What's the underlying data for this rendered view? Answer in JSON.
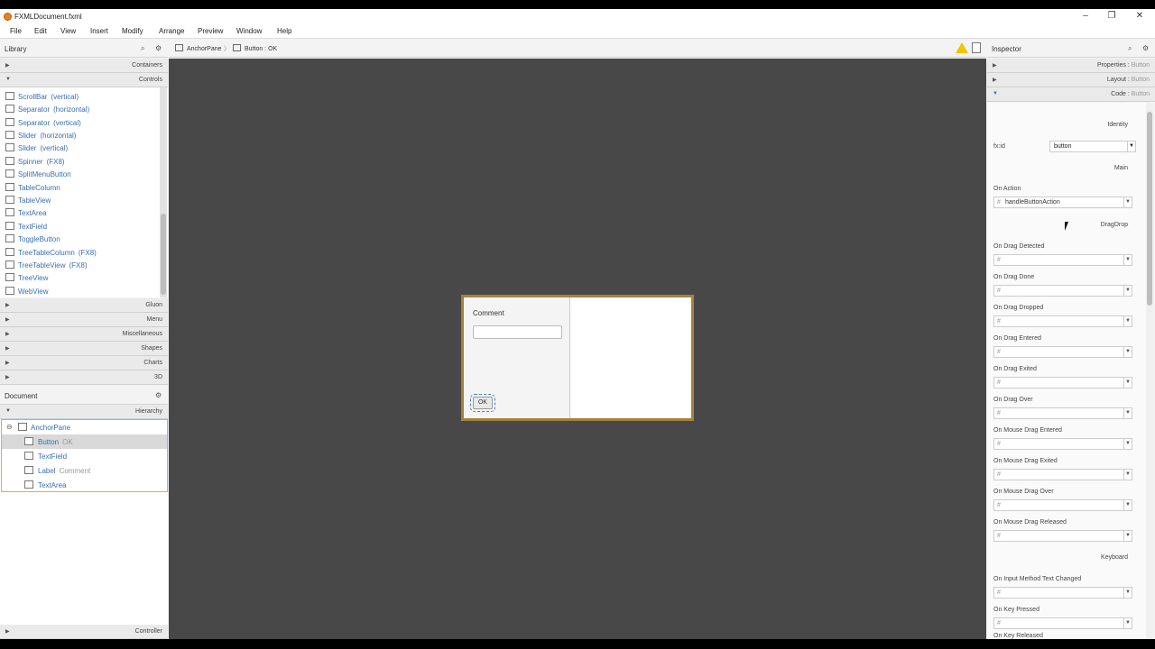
{
  "window": {
    "title": "FXMLDocument.fxml"
  },
  "menu": [
    "File",
    "Edit",
    "View",
    "Insert",
    "Modify",
    "Arrange",
    "Preview",
    "Window",
    "Help"
  ],
  "library": {
    "title": "Library",
    "sections_top": [
      "Containers",
      "Controls"
    ],
    "items": [
      {
        "name": "ScrollBar",
        "sub": "(vertical)"
      },
      {
        "name": "Separator",
        "sub": "(horizontal)"
      },
      {
        "name": "Separator",
        "sub": "(vertical)"
      },
      {
        "name": "Slider",
        "sub": "(horizontal)"
      },
      {
        "name": "Slider",
        "sub": "(vertical)"
      },
      {
        "name": "Spinner",
        "sub": "(FX8)"
      },
      {
        "name": "SplitMenuButton",
        "sub": ""
      },
      {
        "name": "TableColumn",
        "sub": ""
      },
      {
        "name": "TableView",
        "sub": ""
      },
      {
        "name": "TextArea",
        "sub": ""
      },
      {
        "name": "TextField",
        "sub": ""
      },
      {
        "name": "ToggleButton",
        "sub": ""
      },
      {
        "name": "TreeTableColumn",
        "sub": "(FX8)"
      },
      {
        "name": "TreeTableView",
        "sub": "(FX8)"
      },
      {
        "name": "TreeView",
        "sub": ""
      },
      {
        "name": "WebView",
        "sub": ""
      }
    ],
    "sections_bottom": [
      "Gluon",
      "Menu",
      "Miscellaneous",
      "Shapes",
      "Charts",
      "3D"
    ]
  },
  "document": {
    "title": "Document",
    "hierarchy_label": "Hierarchy",
    "tree": [
      {
        "name": "AnchorPane",
        "sub": ""
      },
      {
        "name": "Button",
        "sub": "OK"
      },
      {
        "name": "TextField",
        "sub": ""
      },
      {
        "name": "Label",
        "sub": "Comment"
      },
      {
        "name": "TextArea",
        "sub": ""
      }
    ],
    "controller_label": "Controller"
  },
  "breadcrumb": [
    {
      "label": "AnchorPane"
    },
    {
      "label": "Button : OK"
    }
  ],
  "stage": {
    "label": "Comment",
    "button": "OK"
  },
  "inspector": {
    "title": "Inspector",
    "sections": [
      {
        "label": "Properties : ",
        "sub": "Button"
      },
      {
        "label": "Layout : ",
        "sub": "Button"
      },
      {
        "label": "Code : ",
        "sub": "Button"
      }
    ],
    "identity": "Identity",
    "fxid_label": "fx:id",
    "fxid_value": "button",
    "main": "Main",
    "on_action_label": "On Action",
    "on_action_value": "handleButtonAction",
    "dragdrop": "DragDrop",
    "drag_fields": [
      "On Drag Detected",
      "On Drag Done",
      "On Drag Dropped",
      "On Drag Entered",
      "On Drag Exited",
      "On Drag Over",
      "On Mouse Drag Entered",
      "On Mouse Drag Exited",
      "On Mouse Drag Over",
      "On Mouse Drag Released"
    ],
    "keyboard": "Keyboard",
    "key_fields": [
      "On Input Method Text Changed",
      "On Key Pressed",
      "On Key Released"
    ]
  }
}
